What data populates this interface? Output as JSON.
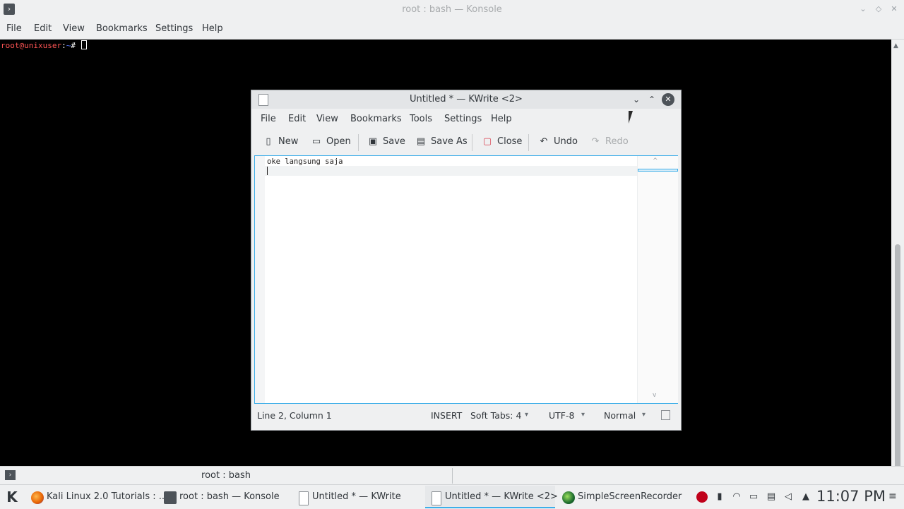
{
  "konsole": {
    "title": "root : bash — Konsole",
    "menu": [
      "File",
      "Edit",
      "View",
      "Bookmarks",
      "Settings",
      "Help"
    ],
    "prompt_user": "root@unixuser",
    "prompt_sep": ":",
    "prompt_path": "~",
    "prompt_end": "# ",
    "tab_label": "root : bash"
  },
  "kwrite": {
    "title": "Untitled * — KWrite <2>",
    "menu": [
      "File",
      "Edit",
      "View",
      "Bookmarks",
      "Tools",
      "Settings",
      "Help"
    ],
    "toolbar": {
      "new": "New",
      "open": "Open",
      "save": "Save",
      "save_as": "Save As",
      "close": "Close",
      "undo": "Undo",
      "redo": "Redo"
    },
    "editor_text": "oke langsung saja",
    "status": {
      "position": "Line 2, Column 1",
      "mode": "INSERT",
      "tabs": "Soft Tabs: 4",
      "encoding": "UTF-8",
      "highlight": "Normal"
    }
  },
  "taskbar": {
    "tasks": [
      {
        "label": "Kali Linux 2.0 Tutorials : ...",
        "icon": "firefox-icon"
      },
      {
        "label": "root : bash — Konsole",
        "icon": "konsole-icon"
      },
      {
        "label": "Untitled * — KWrite",
        "icon": "kwrite-icon"
      },
      {
        "label": "Untitled * — KWrite <2>",
        "icon": "kwrite-icon"
      },
      {
        "label": "SimpleScreenRecorder",
        "icon": "screenrecorder-icon"
      }
    ],
    "clock": "11:07 PM"
  },
  "colors": {
    "accent": "#3daee9",
    "prompt_user": "#ff5555",
    "prompt_path": "#5c7aff"
  }
}
